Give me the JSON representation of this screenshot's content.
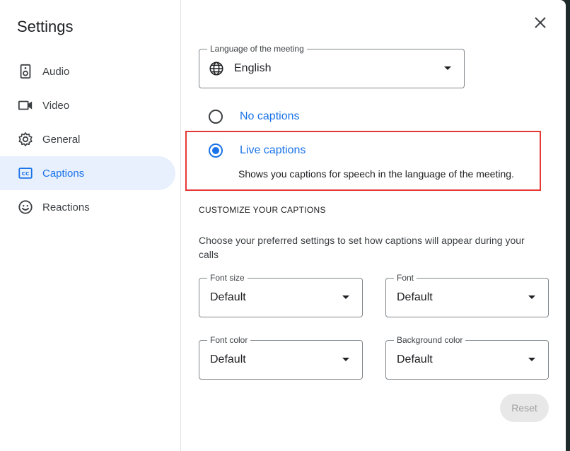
{
  "sidebar": {
    "title": "Settings",
    "items": [
      {
        "label": "Audio",
        "icon": "speaker-icon"
      },
      {
        "label": "Video",
        "icon": "video-camera-icon"
      },
      {
        "label": "General",
        "icon": "gear-icon"
      },
      {
        "label": "Captions",
        "icon": "closed-captions-icon",
        "active": true
      },
      {
        "label": "Reactions",
        "icon": "smiley-icon"
      }
    ]
  },
  "main": {
    "language_field": {
      "label": "Language of the meeting",
      "value": "English",
      "icon": "globe-icon"
    },
    "caption_options": [
      {
        "label": "No captions",
        "checked": false
      },
      {
        "label": "Live captions",
        "checked": true,
        "description": "Shows you captions for speech in the language of the meeting."
      }
    ],
    "customize": {
      "title": "CUSTOMIZE YOUR CAPTIONS",
      "description": "Choose your preferred settings to set how captions will appear during your calls",
      "font_size": {
        "label": "Font size",
        "value": "Default"
      },
      "font": {
        "label": "Font",
        "value": "Default"
      },
      "font_color": {
        "label": "Font color",
        "value": "Default"
      },
      "background_color": {
        "label": "Background color",
        "value": "Default"
      }
    },
    "reset_label": "Reset"
  },
  "colors": {
    "accent": "#1a73e8",
    "highlight_border": "#e53935",
    "active_nav_bg": "#e8f0fe"
  }
}
